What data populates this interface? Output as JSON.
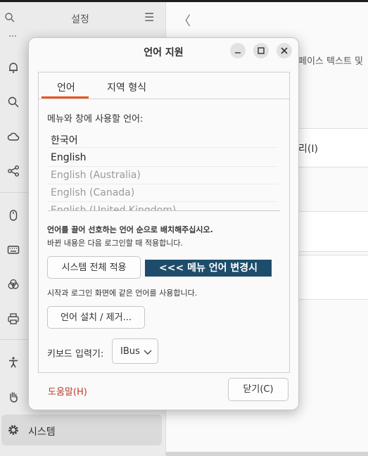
{
  "sidebar": {
    "title": "설정",
    "items": [
      {
        "icon": "bell-icon"
      },
      {
        "icon": "search-icon"
      },
      {
        "icon": "cloud-icon"
      },
      {
        "icon": "share-icon"
      },
      {
        "icon": "mouse-icon"
      },
      {
        "icon": "keyboard-icon"
      },
      {
        "icon": "color-icon"
      },
      {
        "icon": "printer-icon"
      },
      {
        "icon": "accessibility-icon"
      },
      {
        "icon": "hand-icon"
      }
    ],
    "active_item": {
      "icon": "gear-icon",
      "label": "시스템"
    }
  },
  "content": {
    "partial_text": "페이스 텍스트 및",
    "card_text": "리(I)"
  },
  "dialog": {
    "title": "언어 지원",
    "tabs": [
      "언어",
      "지역 형식"
    ],
    "active_tab": "언어",
    "lang_caption": "메뉴와 창에 사용할 언어:",
    "languages": [
      {
        "name": "한국어",
        "enabled": true
      },
      {
        "name": "English",
        "enabled": true
      },
      {
        "name": "English (Australia)",
        "enabled": false
      },
      {
        "name": "English (Canada)",
        "enabled": false
      },
      {
        "name": "English (United Kingdom)",
        "enabled": false
      }
    ],
    "hint_bold": "언어를 끌어 선호하는 언어 순으로 배치해주십시오.",
    "hint": "바뀐 내용은 다음 로그인할 때 적용합니다.",
    "apply_system_button": "시스템 전체 적용",
    "annotation": "<<< 메뉴 언어 변경시",
    "hint2": "시작과 로그인 화면에 같은 언어를 사용합니다.",
    "install_button": "언어 설치 / 제거...",
    "keyboard_label": "키보드 입력기:",
    "keyboard_value": "IBus",
    "help_label": "도움말(H)",
    "close_label": "닫기(C)"
  },
  "colors": {
    "accent": "#e95420",
    "annotation_bg": "#1e4d6b",
    "help_text": "#c0392b"
  }
}
